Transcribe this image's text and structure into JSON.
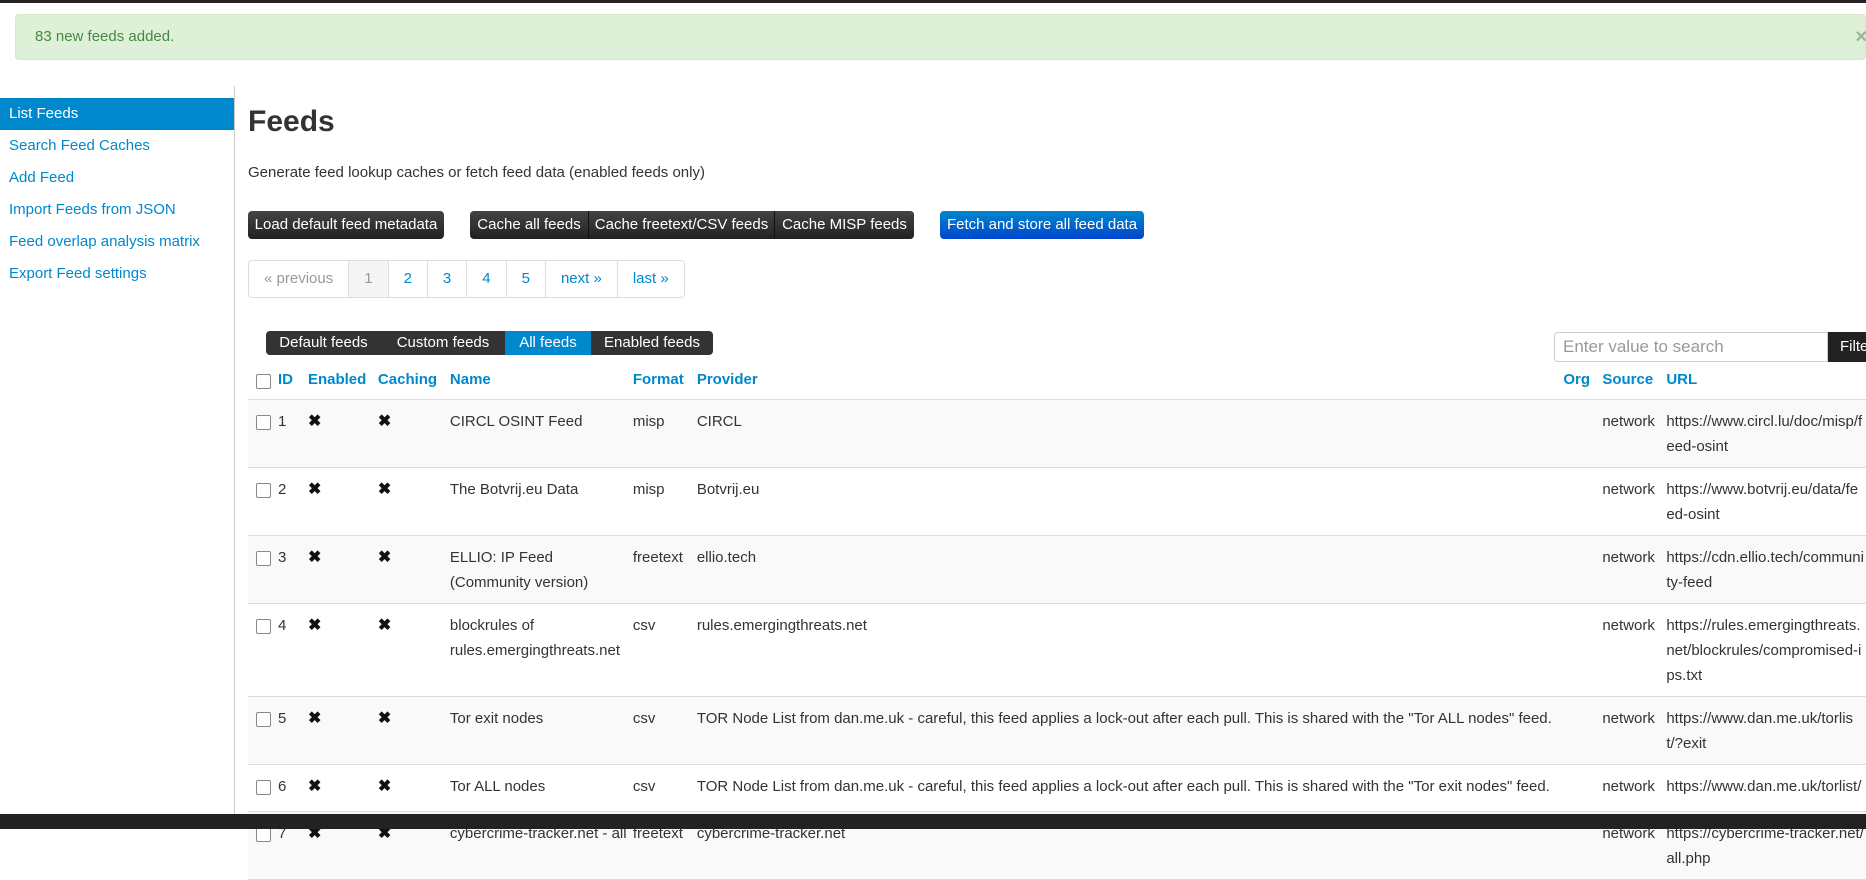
{
  "flash": {
    "message": "83 new feeds added.",
    "close": "×"
  },
  "sidebar": {
    "items": [
      {
        "label": "List Feeds",
        "active": true
      },
      {
        "label": "Search Feed Caches"
      },
      {
        "label": "Add Feed"
      },
      {
        "label": "Import Feeds from JSON"
      },
      {
        "label": "Feed overlap analysis matrix"
      },
      {
        "label": "Export Feed settings"
      }
    ]
  },
  "page": {
    "title": "Feeds",
    "subtitle": "Generate feed lookup caches or fetch feed data (enabled feeds only)"
  },
  "actions": {
    "load_default": "Load default feed metadata",
    "cache_all": "Cache all feeds",
    "cache_freetext": "Cache freetext/CSV feeds",
    "cache_misp": "Cache MISP feeds",
    "fetch_all": "Fetch and store all feed data"
  },
  "pagination": {
    "previous": "« previous",
    "pages": [
      "1",
      "2",
      "3",
      "4",
      "5"
    ],
    "current": "1",
    "next": "next »",
    "last": "last »"
  },
  "filter_tabs": {
    "default": "Default feeds",
    "custom": "Custom feeds",
    "all": "All feeds",
    "enabled": "Enabled feeds",
    "active": "All feeds"
  },
  "search": {
    "placeholder": "Enter value to search",
    "button": "Filter"
  },
  "table": {
    "headers": {
      "id": "ID",
      "enabled": "Enabled",
      "caching": "Caching",
      "name": "Name",
      "format": "Format",
      "provider": "Provider",
      "org": "Org",
      "source": "Source",
      "url": "URL"
    },
    "x_mark": "✖",
    "rows": [
      {
        "id": "1",
        "name": "CIRCL OSINT Feed",
        "format": "misp",
        "provider": "CIRCL",
        "org": "",
        "source": "network",
        "url": "https://www.circl.lu/doc/misp/feed-osint"
      },
      {
        "id": "2",
        "name": "The Botvrij.eu Data",
        "format": "misp",
        "provider": "Botvrij.eu",
        "org": "",
        "source": "network",
        "url": "https://www.botvrij.eu/data/feed-osint"
      },
      {
        "id": "3",
        "name": "ELLIO: IP Feed (Community version)",
        "format": "freetext",
        "provider": "ellio.tech",
        "org": "",
        "source": "network",
        "url": "https://cdn.ellio.tech/community-feed"
      },
      {
        "id": "4",
        "name": "blockrules of rules.emergingthreats.net",
        "format": "csv",
        "provider": "rules.emergingthreats.net",
        "org": "",
        "source": "network",
        "url": "https://rules.emergingthreats.net/blockrules/compromised-ips.txt"
      },
      {
        "id": "5",
        "name": "Tor exit nodes",
        "format": "csv",
        "provider": "TOR Node List from dan.me.uk - careful, this feed applies a lock-out after each pull. This is shared with the \"Tor ALL nodes\" feed.",
        "org": "",
        "source": "network",
        "url": "https://www.dan.me.uk/torlist/?exit"
      },
      {
        "id": "6",
        "name": "Tor ALL nodes",
        "format": "csv",
        "provider": "TOR Node List from dan.me.uk - careful, this feed applies a lock-out after each pull. This is shared with the \"Tor exit nodes\" feed.",
        "org": "",
        "source": "network",
        "url": "https://www.dan.me.uk/torlist/"
      },
      {
        "id": "7",
        "name": "cybercrime-tracker.net - all",
        "format": "freetext",
        "provider": "cybercrime-tracker.net",
        "org": "",
        "source": "network",
        "url": "https://cybercrime-tracker.net/all.php"
      }
    ]
  }
}
